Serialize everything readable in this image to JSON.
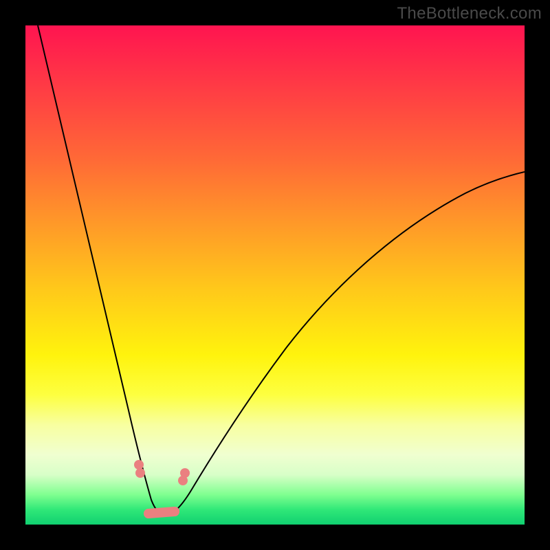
{
  "watermark": "TheBottleneck.com",
  "colors": {
    "dot": "#ea8080",
    "curve": "#000000",
    "frame": "#000000"
  },
  "chart_data": {
    "type": "line",
    "title": "",
    "xlabel": "",
    "ylabel": "",
    "xlim": [
      0,
      100
    ],
    "ylim": [
      0,
      100
    ],
    "grid": false,
    "legend": false,
    "series": [
      {
        "name": "left-branch",
        "x": [
          2,
          5,
          8,
          11,
          14,
          17,
          19,
          21,
          23,
          24,
          25,
          26,
          27,
          28
        ],
        "y": [
          100,
          88,
          76,
          64,
          52,
          40,
          30,
          20,
          10,
          6,
          3,
          2,
          1.5,
          1.8
        ]
      },
      {
        "name": "right-branch",
        "x": [
          28,
          30,
          32,
          35,
          38,
          42,
          47,
          53,
          60,
          68,
          77,
          88,
          100
        ],
        "y": [
          1.8,
          2,
          3,
          6,
          10,
          16,
          24,
          32,
          40,
          48,
          56,
          64,
          70
        ]
      }
    ],
    "markers": [
      {
        "label": "dot-left-upper",
        "x": 22.7,
        "y": 12.0
      },
      {
        "label": "dot-left-lower",
        "x": 23.0,
        "y": 10.3
      },
      {
        "label": "dot-right-upper",
        "x": 32.0,
        "y": 10.3
      },
      {
        "label": "dot-right-lower",
        "x": 31.6,
        "y": 8.8
      },
      {
        "label": "bar-left-end",
        "x": 24.6,
        "y": 2.2
      },
      {
        "label": "bar-right-end",
        "x": 29.9,
        "y": 2.6
      }
    ],
    "bottom_highlight": {
      "x_start": 24.6,
      "x_end": 29.9,
      "y": 2.3
    }
  }
}
